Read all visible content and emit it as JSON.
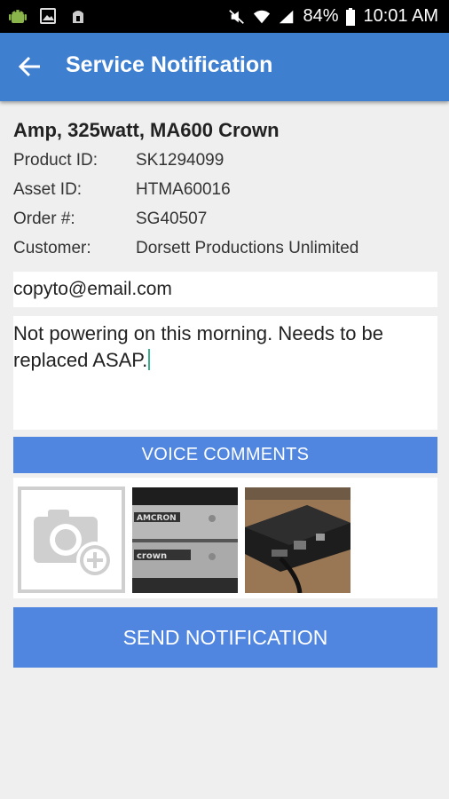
{
  "status_bar": {
    "battery": "84%",
    "time": "10:01 AM"
  },
  "appbar": {
    "title": "Service Notification"
  },
  "item": {
    "title": "Amp, 325watt, MA600 Crown",
    "fields": [
      {
        "label": "Product ID:",
        "value": "SK1294099"
      },
      {
        "label": "Asset ID:",
        "value": "HTMA60016"
      },
      {
        "label": "Order #:",
        "value": "SG40507"
      },
      {
        "label": "Customer:",
        "value": "Dorsett Productions Unlimited"
      }
    ]
  },
  "form": {
    "email_value": "copyto@email.com",
    "comment_value": "Not powering on this morning. Needs to be replaced ASAP."
  },
  "buttons": {
    "voice_comments": "VOICE COMMENTS",
    "send_notification": "SEND NOTIFICATION"
  },
  "photos": {
    "thumb1_brand_top": "AMCRON",
    "thumb1_brand_bottom": "crown"
  }
}
